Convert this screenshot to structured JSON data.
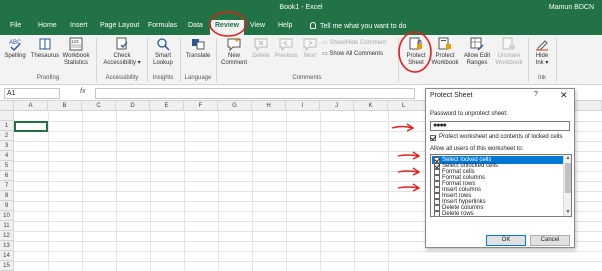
{
  "app": {
    "title": "Book1 - Excel",
    "user": "Mamun BDCN"
  },
  "menu": {
    "tabs": [
      "File",
      "Home",
      "Insert",
      "Page Layout",
      "Formulas",
      "Data",
      "Review",
      "View",
      "Help"
    ],
    "tell_me": "Tell me what you want to do"
  },
  "ribbon": {
    "spelling": "Spelling",
    "thesaurus": "Thesaurus",
    "workbook_statistics_1": "Workbook",
    "workbook_statistics_2": "Statistics",
    "group_proofing": "Proofing",
    "check_accessibility_1": "Check",
    "check_accessibility_2": "Accessibility ▾",
    "group_accessibility": "Accessibility",
    "smart_lookup_1": "Smart",
    "smart_lookup_2": "Lookup",
    "group_insights": "Insights",
    "translate": "Translate",
    "group_language": "Language",
    "new_comment_1": "New",
    "new_comment_2": "Comment",
    "delete": "Delete",
    "previous": "Previous",
    "next": "Next",
    "show_hide_comment": "Show/Hide Comment",
    "show_all_comments": "Show All Comments",
    "group_comments": "Comments",
    "protect_sheet_1": "Protect",
    "protect_sheet_2": "Sheet",
    "protect_workbook_1": "Protect",
    "protect_workbook_2": "Workbook",
    "allow_edit_ranges_1": "Allow Edit",
    "allow_edit_ranges_2": "Ranges",
    "unshare_workbook_1": "Unshare",
    "unshare_workbook_2": "Workbook",
    "hide_ink_1": "Hide",
    "hide_ink_2": "Ink ▾",
    "group_ink": "Ink"
  },
  "formula_bar": {
    "name_box": "A1",
    "fx": "fx",
    "value": ""
  },
  "grid": {
    "columns": [
      "A",
      "B",
      "C",
      "D",
      "E",
      "F",
      "G",
      "H",
      "I",
      "J",
      "K",
      "L"
    ],
    "rows": [
      "1",
      "2",
      "3",
      "4",
      "5",
      "6",
      "7",
      "8",
      "9",
      "10",
      "11",
      "12",
      "13",
      "14",
      "15",
      "16"
    ]
  },
  "dialog": {
    "title": "Protect Sheet",
    "help": "?",
    "close": "✕",
    "password_label": "Password to unprotect sheet:",
    "password_value": "●●●●",
    "protect_contents_label": "Protect worksheet and contents of locked cells",
    "protect_contents_checked": true,
    "allow_label": "Allow all users of this worksheet to:",
    "permissions": [
      {
        "label": "Select locked cells",
        "checked": true,
        "selected": true
      },
      {
        "label": "Select unlocked cells",
        "checked": true,
        "selected": false
      },
      {
        "label": "Format cells",
        "checked": false,
        "selected": false
      },
      {
        "label": "Format columns",
        "checked": false,
        "selected": false
      },
      {
        "label": "Format rows",
        "checked": false,
        "selected": false
      },
      {
        "label": "Insert columns",
        "checked": false,
        "selected": false
      },
      {
        "label": "Insert rows",
        "checked": false,
        "selected": false
      },
      {
        "label": "Insert hyperlinks",
        "checked": false,
        "selected": false
      },
      {
        "label": "Delete columns",
        "checked": false,
        "selected": false
      },
      {
        "label": "Delete rows",
        "checked": false,
        "selected": false
      }
    ],
    "ok": "OK",
    "cancel": "Cancel"
  },
  "colors": {
    "excel_green": "#217346",
    "ribbon_bg": "#f3f3f3",
    "selection_blue": "#0078d7",
    "annotation_red": "#e0201c"
  }
}
